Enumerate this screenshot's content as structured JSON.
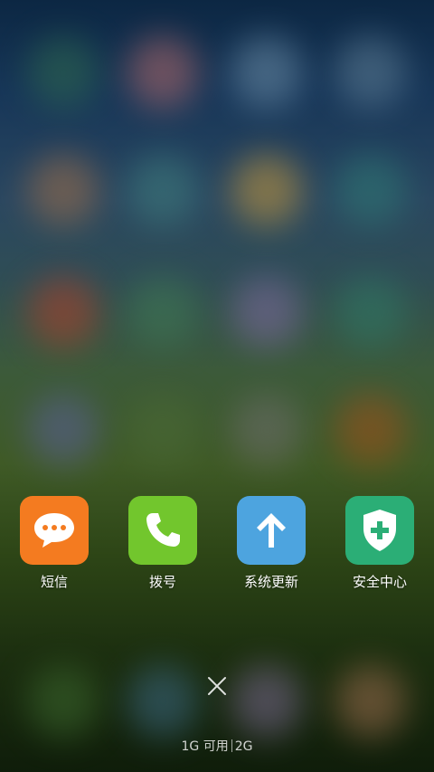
{
  "recent_apps": [
    {
      "label": "短信",
      "icon": "message-bubble-icon",
      "color": "#F47B20"
    },
    {
      "label": "拨号",
      "icon": "phone-icon",
      "color": "#72C62D"
    },
    {
      "label": "系统更新",
      "icon": "arrow-up-icon",
      "color": "#4DA4DF"
    },
    {
      "label": "安全中心",
      "icon": "shield-plus-icon",
      "color": "#2BAE76"
    }
  ],
  "close_button": {
    "icon": "close-icon"
  },
  "memory": {
    "available": "1G 可用",
    "total": "2G"
  },
  "colors": {
    "background_top": "#0C2743",
    "background_bottom": "#0F1D0A",
    "text": "#FFFFFF"
  }
}
